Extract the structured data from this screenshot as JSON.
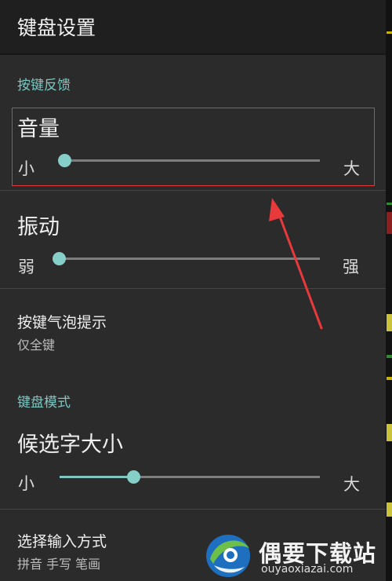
{
  "header": {
    "title": "键盘设置"
  },
  "sections": {
    "key_feedback": {
      "label": "按键反馈"
    },
    "keyboard_mode": {
      "label": "键盘模式"
    }
  },
  "volume": {
    "label": "音量",
    "min_label": "小",
    "max_label": "大",
    "value": 0.0
  },
  "vibration": {
    "label": "振动",
    "min_label": "弱",
    "max_label": "强",
    "value": 0.0
  },
  "bubble": {
    "title": "按键气泡提示",
    "value": "仅全键"
  },
  "candidate_size": {
    "label": "候选字大小",
    "min_label": "小",
    "max_label": "大",
    "value": 0.29
  },
  "input_method": {
    "title": "选择输入方式",
    "value": "拼音 手写 笔画"
  },
  "watermark": {
    "brand": "偶要下载站",
    "url": "ouyaoxiazai.com"
  },
  "colors": {
    "accent": "#7fc6c1",
    "highlight_box": "#e0393b",
    "arrow": "#e8393b"
  }
}
